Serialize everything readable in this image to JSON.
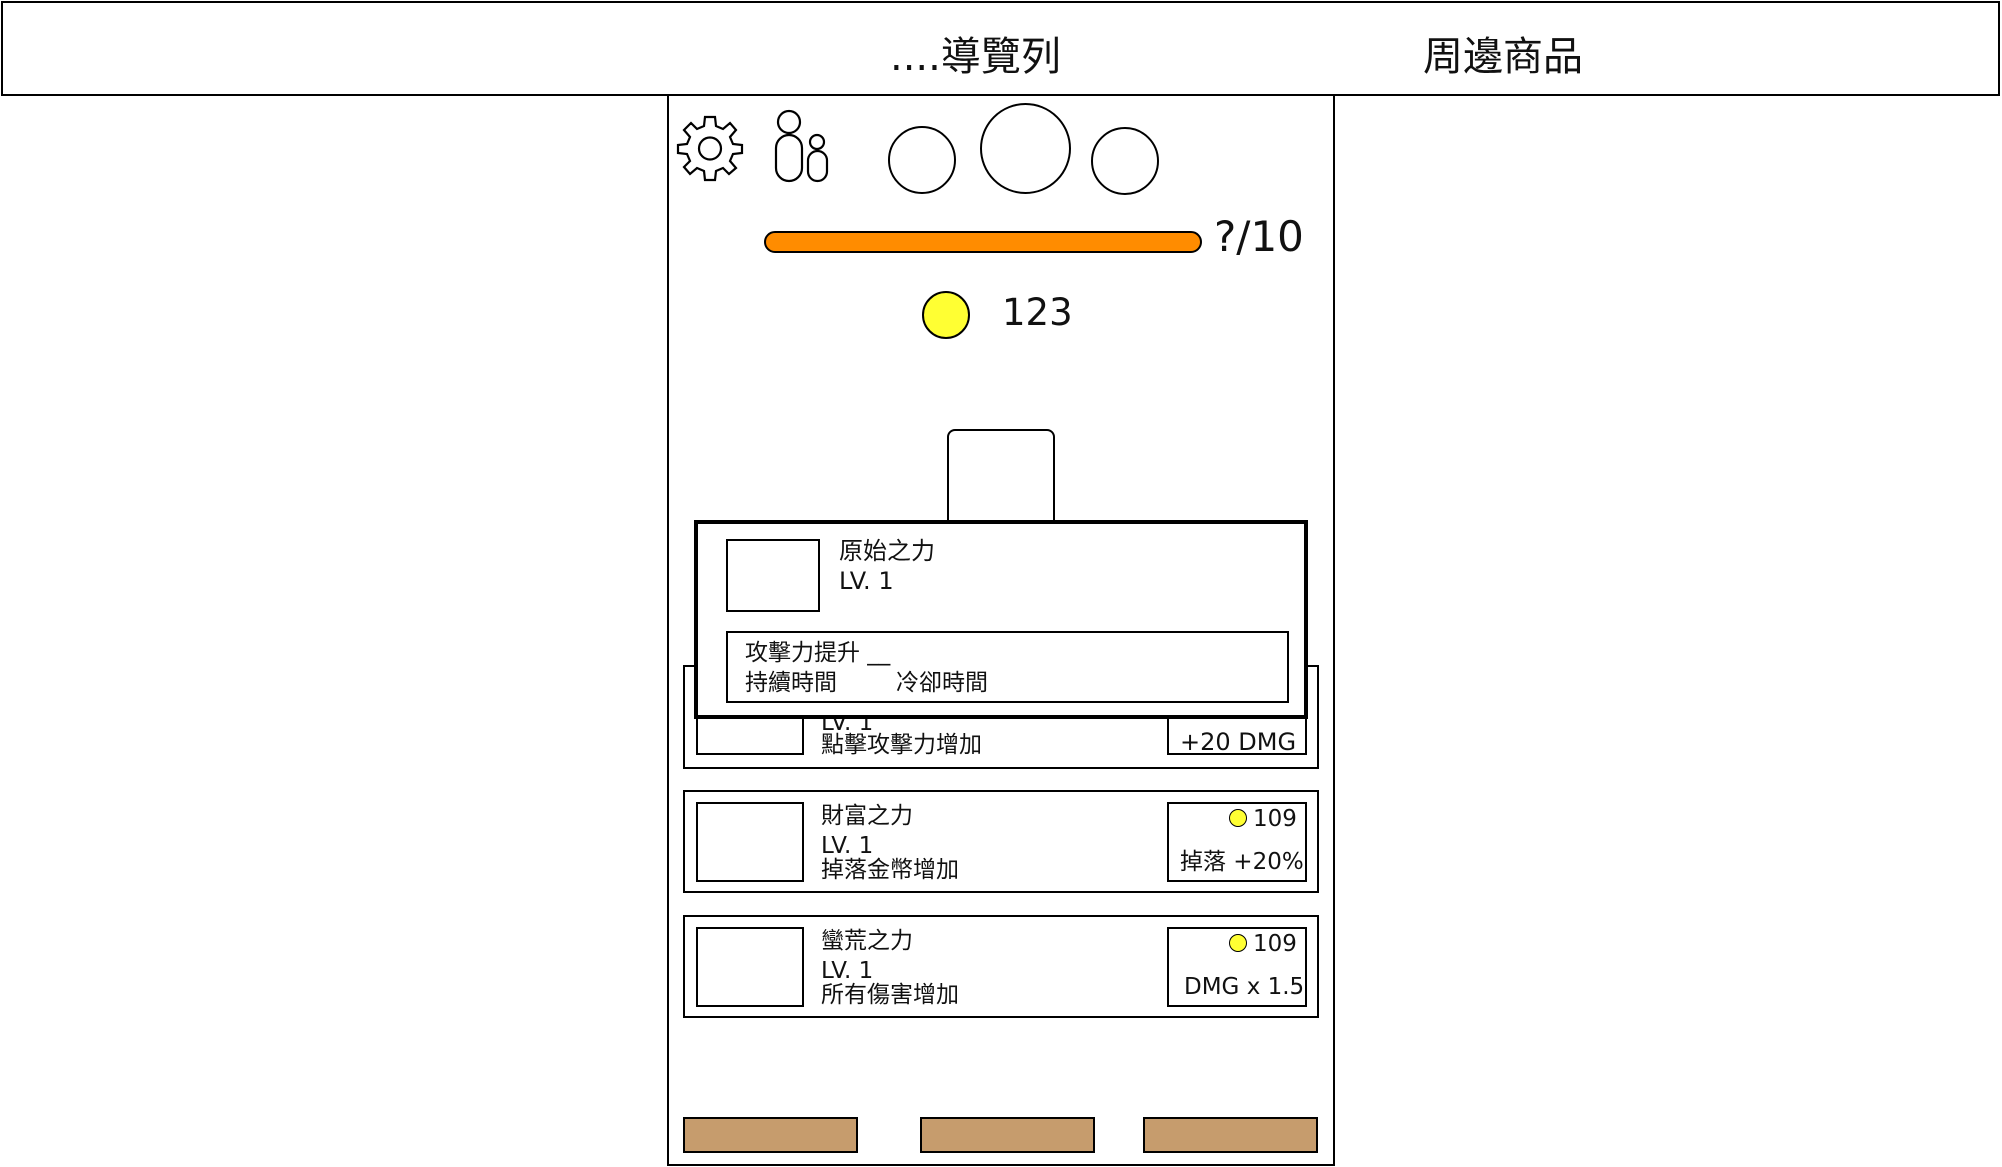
{
  "header": {
    "nav_label": "....導覽列",
    "merch_label": "周邊商品"
  },
  "top_icons": {
    "settings": "gear-icon",
    "friends": "users-icon"
  },
  "progress": {
    "label": "?/10",
    "fill_fraction": 1.0,
    "color": "#ff8c00"
  },
  "coins": {
    "amount": "123",
    "color": "#ffff33"
  },
  "upgrades": [
    {
      "level": "LV. 1",
      "desc": "點擊攻擊力增加",
      "effect": "+20 DMG"
    },
    {
      "name": "財富之力",
      "level": "LV. 1",
      "desc": "掉落金幣增加",
      "cost": "109",
      "effect": "掉落 +20%"
    },
    {
      "name": "蠻荒之力",
      "level": "LV. 1",
      "desc": "所有傷害增加",
      "cost": "109",
      "effect": "DMG x 1.5"
    }
  ],
  "popup": {
    "name": "原始之力",
    "level": "LV. 1",
    "line1": "攻擊力提升 __",
    "line2_a": "持續時間",
    "line2_b": "冷卻時間"
  },
  "bottom_nav": {
    "color": "#c69c6d"
  }
}
